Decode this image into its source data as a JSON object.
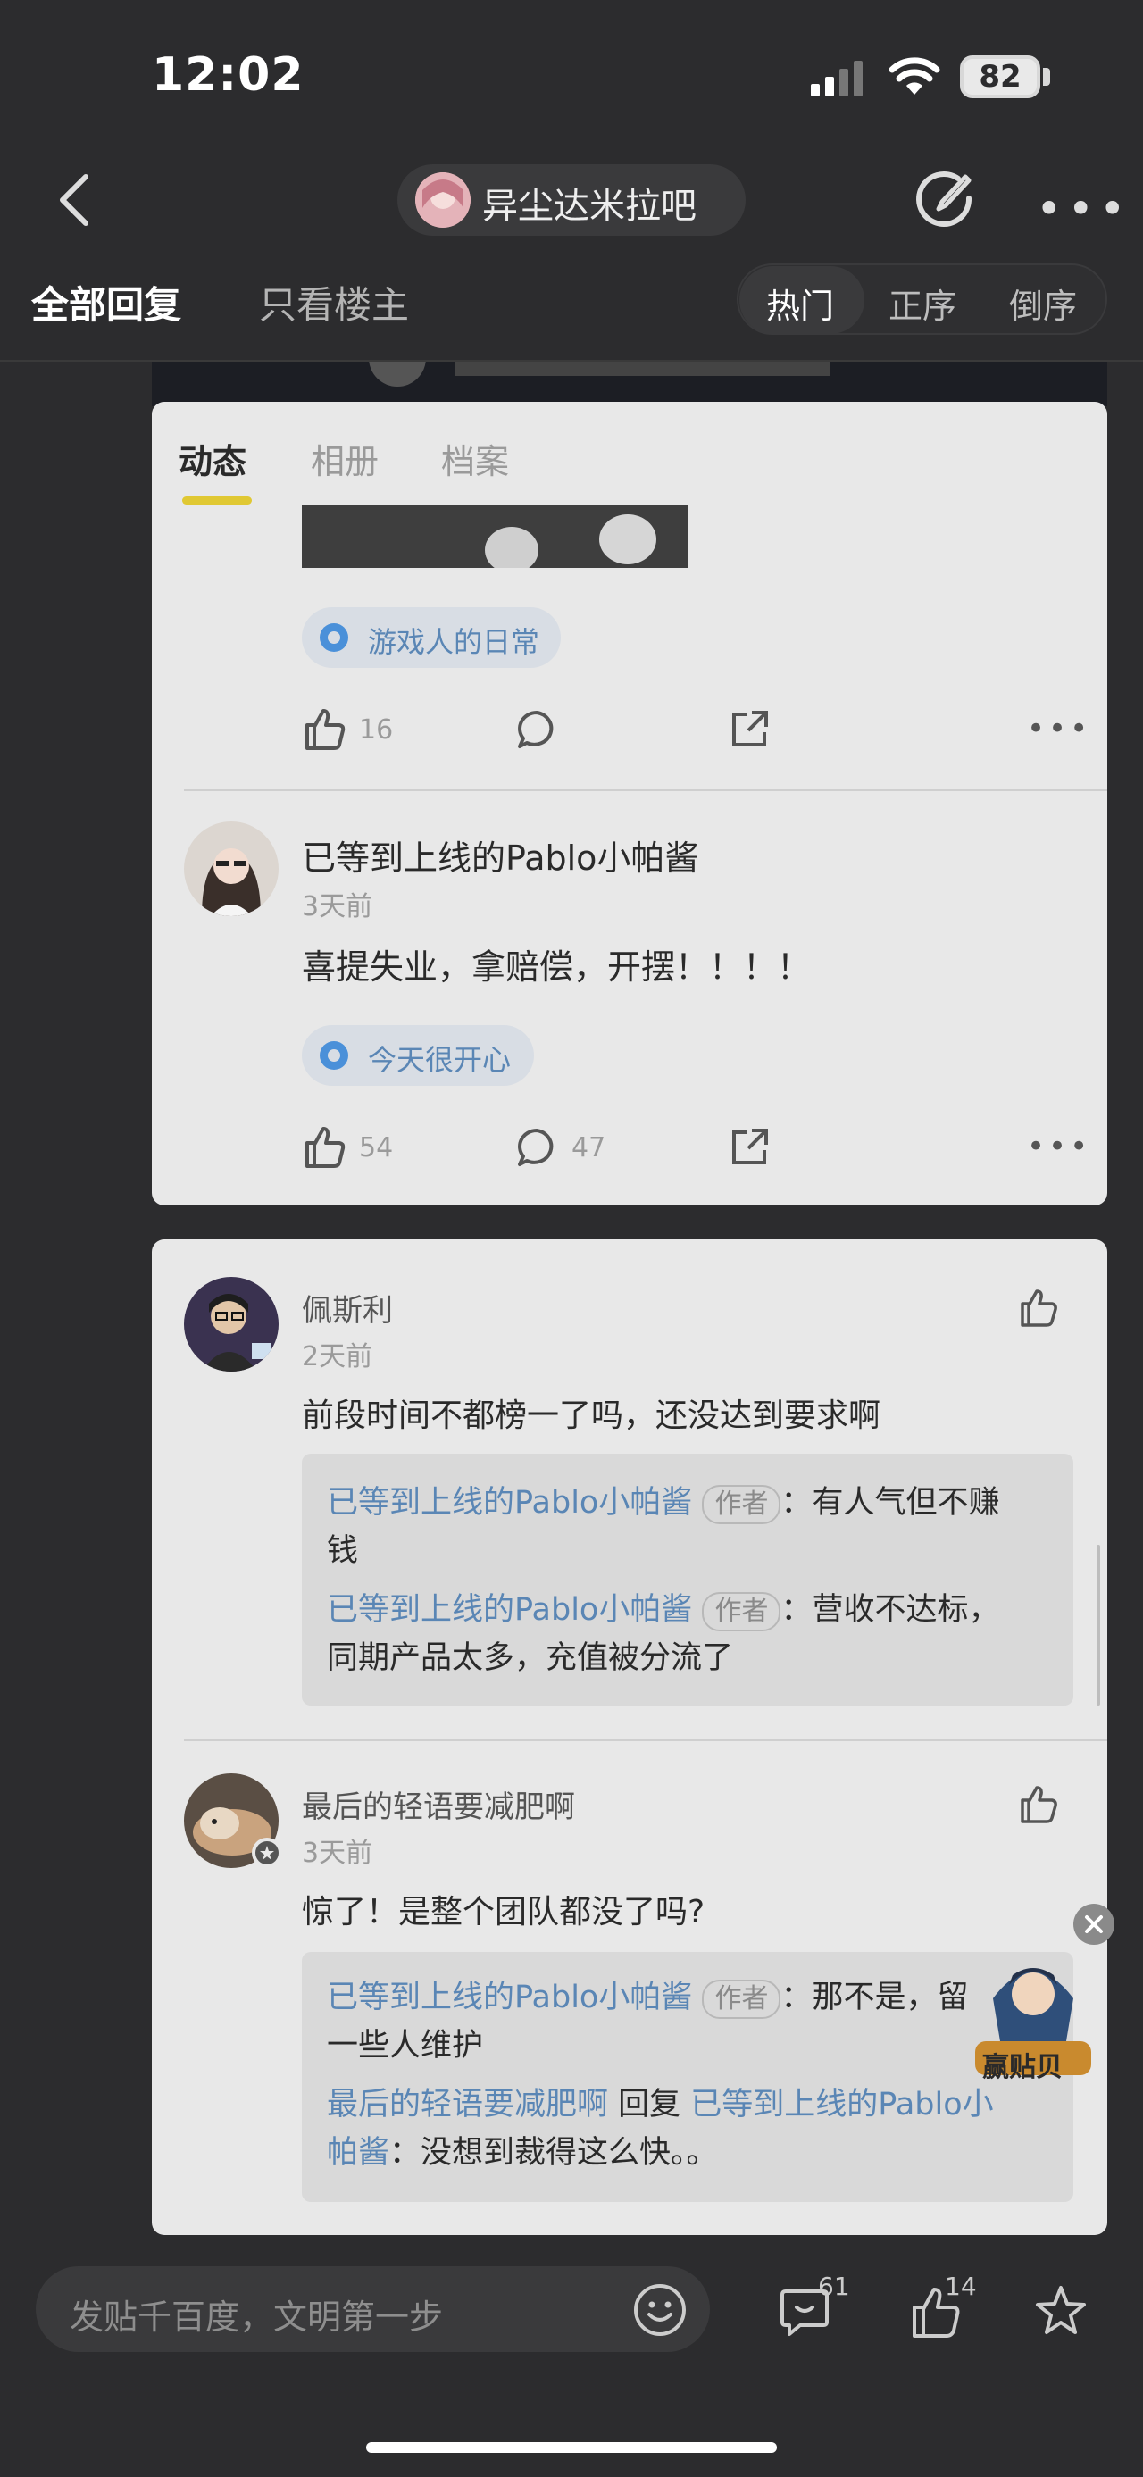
{
  "status": {
    "time": "12:02",
    "battery": "82"
  },
  "nav": {
    "forum_name": "异尘达米拉吧"
  },
  "tabs": {
    "all": "全部回复",
    "op_only": "只看楼主",
    "sort_hot": "热门",
    "sort_seq": "正序",
    "sort_rev": "倒序"
  },
  "profile_card": {
    "tabs": [
      "动态",
      "相册",
      "档案"
    ],
    "post1": {
      "topic": "游戏人的日常",
      "likes": "16"
    },
    "post2": {
      "author": "已等到上线的Pablo小帕酱",
      "time": "3天前",
      "content": "喜提失业，拿赔偿，开摆！！！！",
      "topic": "今天很开心",
      "likes": "54",
      "comments": "47"
    }
  },
  "comments": [
    {
      "author": "佩斯利",
      "time": "2天前",
      "content": "前段时间不都榜一了吗，还没达到要求啊",
      "replies": [
        {
          "author": "已等到上线的Pablo小帕酱",
          "badge": "作者",
          "line1": "：有人气但不赚",
          "line2": "钱"
        },
        {
          "author": "已等到上线的Pablo小帕酱",
          "badge": "作者",
          "line1": "：营收不达标，",
          "line2": "同期产品太多，充值被分流了"
        }
      ]
    },
    {
      "author": "最后的轻语要减肥啊",
      "time": "3天前",
      "content": "惊了！是整个团队都没了吗?",
      "replies": [
        {
          "author": "已等到上线的Pablo小帕酱",
          "badge": "作者",
          "line1": "：那不是，留",
          "line2": "一些人维护"
        },
        {
          "author": "最后的轻语要减肥啊",
          "reply_word": " 回复 ",
          "target_a": "已等到上线的Pablo小",
          "target_b": "帕酱",
          "text": "：没想到裁得这么快。。"
        }
      ]
    }
  ],
  "promo": {
    "label": "赢贴贝"
  },
  "bottom": {
    "placeholder": "发贴千百度，文明第一步",
    "comment_count": "61",
    "like_count": "14"
  },
  "colors": {
    "background": "#2c2c2e",
    "card": "#e8e8e8",
    "link_blue": "#5a86b5",
    "tab_underline": "#e0c833"
  }
}
